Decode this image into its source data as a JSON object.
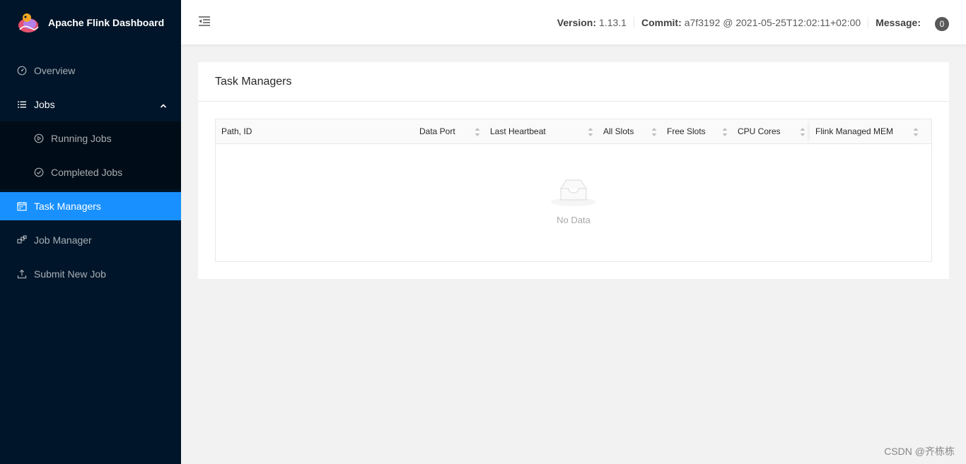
{
  "app": {
    "title": "Apache Flink Dashboard"
  },
  "sidebar": {
    "items": [
      {
        "label": "Overview"
      },
      {
        "label": "Jobs"
      },
      {
        "label": "Running Jobs"
      },
      {
        "label": "Completed Jobs"
      },
      {
        "label": "Task Managers"
      },
      {
        "label": "Job Manager"
      },
      {
        "label": "Submit New Job"
      }
    ]
  },
  "header": {
    "version_label": "Version:",
    "version_value": "1.13.1",
    "commit_label": "Commit:",
    "commit_value": "a7f3192 @ 2021-05-25T12:02:11+02:00",
    "message_label": "Message:",
    "message_count": "0"
  },
  "main": {
    "title": "Task Managers",
    "columns": [
      "Path, ID",
      "Data Port",
      "Last Heartbeat",
      "All Slots",
      "Free Slots",
      "CPU Cores",
      "Flink Managed MEM"
    ],
    "empty_text": "No Data"
  },
  "watermark": "CSDN @齐栋栋",
  "colors": {
    "sidebar_bg": "#001529",
    "accent": "#1890ff",
    "submenu_bg": "#000c17"
  },
  "icons": [
    "flink-logo",
    "dashboard-icon",
    "list-icon",
    "play-circle-icon",
    "check-circle-icon",
    "schedule-icon",
    "cluster-icon",
    "upload-icon",
    "menu-fold-icon",
    "sort-icon",
    "inbox-icon"
  ]
}
